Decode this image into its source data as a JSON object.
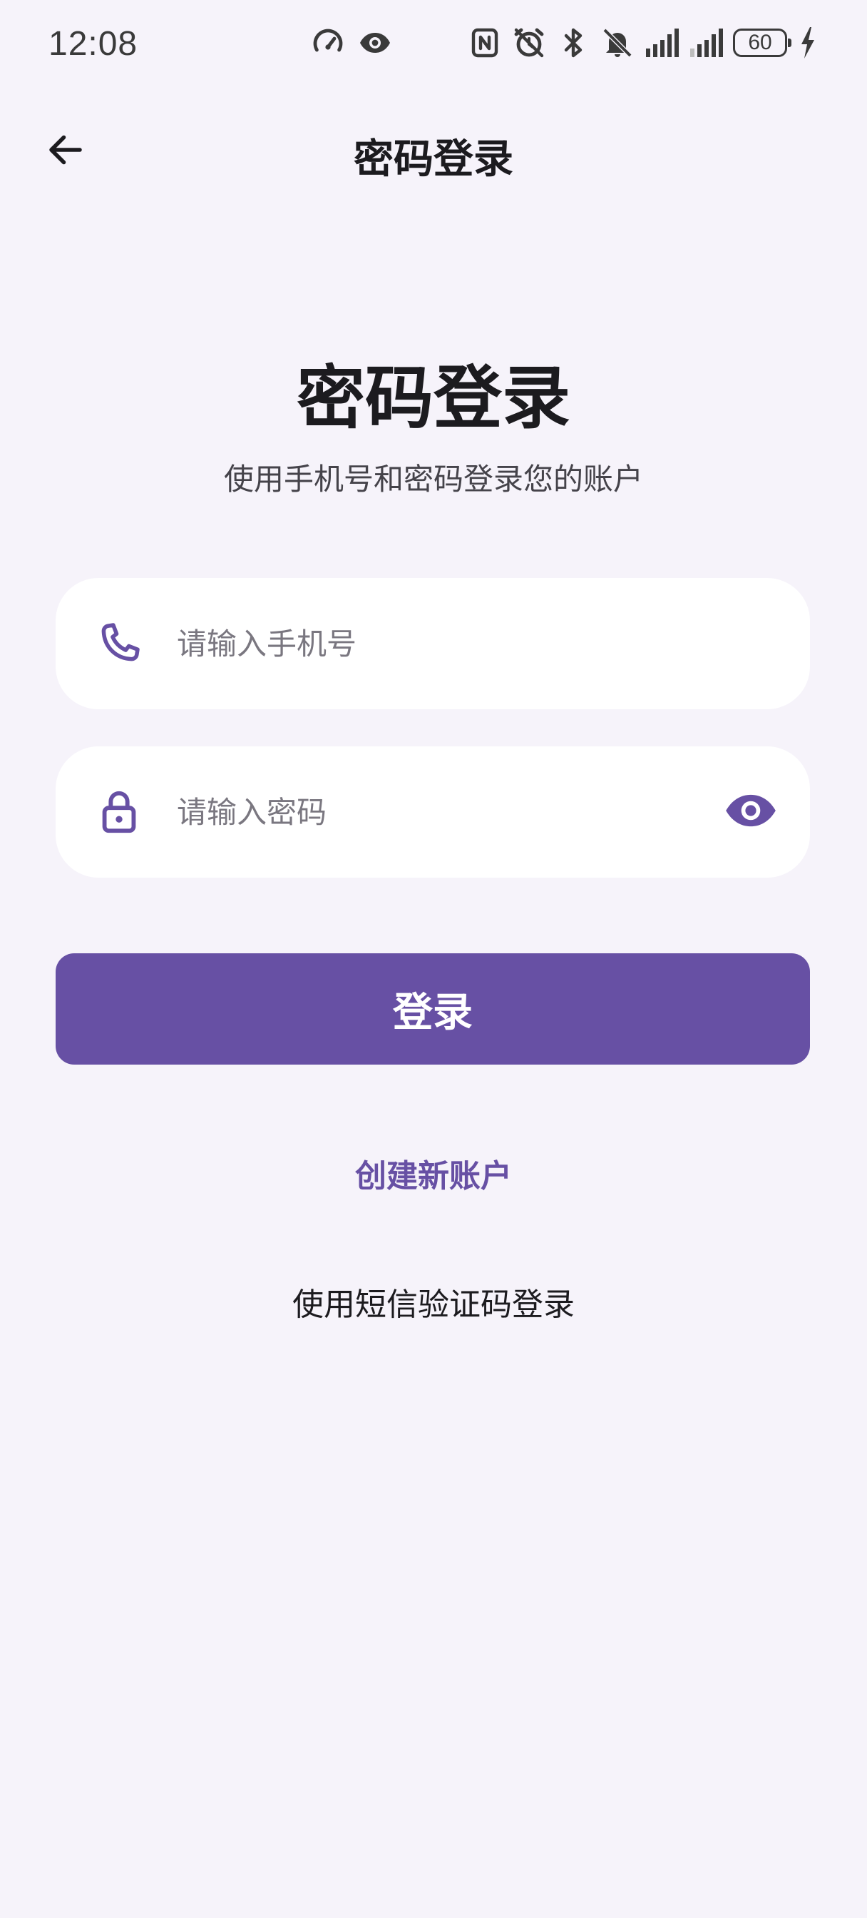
{
  "status_bar": {
    "time": "12:08",
    "battery_level": "60",
    "icons_center": [
      "speedometer-icon",
      "eye-icon"
    ],
    "icons_right": [
      "nfc-icon",
      "alarm-icon",
      "bluetooth-icon",
      "bell-off-icon",
      "signal-icon",
      "signal-icon",
      "battery-icon",
      "charging-icon"
    ]
  },
  "app_bar": {
    "title": "密码登录",
    "back_icon": "arrow-left-icon"
  },
  "header": {
    "title": "密码登录",
    "subtitle": "使用手机号和密码登录您的账户"
  },
  "form": {
    "phone": {
      "icon": "phone-icon",
      "value": "",
      "placeholder": "请输入手机号"
    },
    "password": {
      "icon": "lock-icon",
      "value": "",
      "placeholder": "请输入密码",
      "toggle_icon": "eye-icon"
    },
    "login_label": "登录"
  },
  "links": {
    "create_account": "创建新账户",
    "sms_login": "使用短信验证码登录"
  },
  "colors": {
    "background": "#F6F3FA",
    "primary": "#6750A4",
    "field_background": "#FFFFFF",
    "text": "#1C1B1F"
  }
}
